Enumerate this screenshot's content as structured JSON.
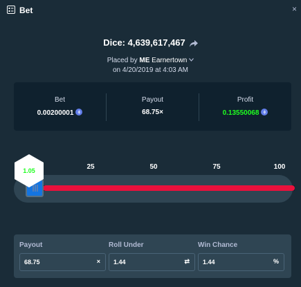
{
  "window": {
    "title": "Bet",
    "icon": "list-icon",
    "close_label": "×"
  },
  "bet": {
    "title": "Dice: 4,639,617,467",
    "placed_by_prefix": "Placed by",
    "user_tag": "ME",
    "username": "Earnertown",
    "date": "on 4/20/2019 at 4:03 AM"
  },
  "stats": {
    "bet_label": "Bet",
    "bet_value": "0.00200001",
    "payout_label": "Payout",
    "payout_value": "68.75×",
    "profit_label": "Profit",
    "profit_value": "0.13550068"
  },
  "slider": {
    "ticks": [
      "25",
      "50",
      "75",
      "100"
    ],
    "result": "1.05",
    "roll_under": 1.44,
    "max": 100
  },
  "fields": {
    "payout_label": "Payout",
    "payout_value": "68.75",
    "payout_suffix": "×",
    "roll_label": "Roll Under",
    "roll_value": "1.44",
    "roll_suffix": "⇄",
    "chance_label": "Win Chance",
    "chance_value": "1.44",
    "chance_suffix": "%"
  },
  "colors": {
    "background": "#1a2c38",
    "panel": "#0f212e",
    "profit": "#1fff20",
    "lose_track": "#e9113c",
    "currency": "#627eea"
  }
}
